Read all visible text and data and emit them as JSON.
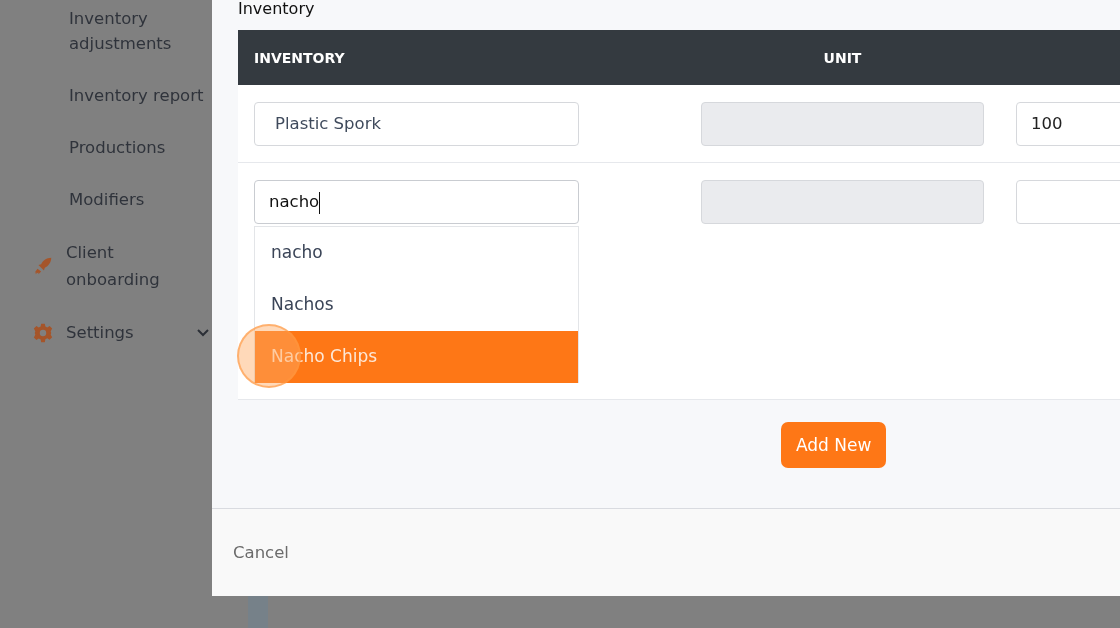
{
  "sidebar": {
    "items": [
      {
        "label": "Inventory adjustments",
        "kind": "sub"
      },
      {
        "label": "Inventory report",
        "kind": "sub"
      },
      {
        "label": "Productions",
        "kind": "sub"
      },
      {
        "label": "Modifiers",
        "kind": "sub"
      },
      {
        "label": "Client onboarding",
        "kind": "rocket"
      },
      {
        "label": "Settings",
        "kind": "gear"
      }
    ]
  },
  "modal": {
    "section_title": "Inventory",
    "table": {
      "columns": [
        "INVENTORY",
        "UNIT"
      ],
      "rows": [
        {
          "inventory": "Plastic Spork",
          "column_3": "100",
          "focused": false
        },
        {
          "inventory": "nacho",
          "focused": true
        }
      ]
    },
    "dropdown": {
      "options": [
        {
          "label": "nacho",
          "selected": false
        },
        {
          "label": "Nachos",
          "selected": false
        },
        {
          "label": "Nacho Chips",
          "selected": true
        }
      ]
    },
    "add_button": "Add New",
    "cancel_button": "Cancel"
  }
}
